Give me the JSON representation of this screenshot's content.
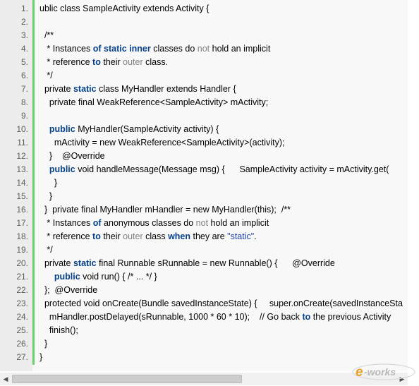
{
  "editor": {
    "lines": [
      {
        "n": "1.",
        "indent": "",
        "segments": [
          {
            "t": "ublic class SampleActivity extends Activity {",
            "c": "txt"
          }
        ]
      },
      {
        "n": "2.",
        "indent": "",
        "segments": []
      },
      {
        "n": "3.",
        "indent": "  ",
        "segments": [
          {
            "t": "/**",
            "c": "txt"
          }
        ]
      },
      {
        "n": "4.",
        "indent": "   ",
        "segments": [
          {
            "t": "* Instances ",
            "c": "txt"
          },
          {
            "t": "of",
            "c": "kw"
          },
          {
            "t": " ",
            "c": "txt"
          },
          {
            "t": "static",
            "c": "kw"
          },
          {
            "t": " ",
            "c": "txt"
          },
          {
            "t": "inner",
            "c": "kw"
          },
          {
            "t": " classes do ",
            "c": "txt"
          },
          {
            "t": "not",
            "c": "fn"
          },
          {
            "t": " hold an implicit",
            "c": "txt"
          }
        ]
      },
      {
        "n": "5.",
        "indent": "   ",
        "segments": [
          {
            "t": "* reference ",
            "c": "txt"
          },
          {
            "t": "to",
            "c": "kw"
          },
          {
            "t": " their ",
            "c": "txt"
          },
          {
            "t": "outer",
            "c": "fn"
          },
          {
            "t": " class.",
            "c": "txt"
          }
        ]
      },
      {
        "n": "6.",
        "indent": "   ",
        "segments": [
          {
            "t": "*/",
            "c": "txt"
          }
        ]
      },
      {
        "n": "7.",
        "indent": "  ",
        "segments": [
          {
            "t": "private ",
            "c": "txt"
          },
          {
            "t": "static",
            "c": "kw"
          },
          {
            "t": " class MyHandler extends Handler {",
            "c": "txt"
          }
        ]
      },
      {
        "n": "8.",
        "indent": "    ",
        "segments": [
          {
            "t": "private final WeakReference<SampleActivity> mActivity;",
            "c": "txt"
          }
        ]
      },
      {
        "n": "9.",
        "indent": "",
        "segments": []
      },
      {
        "n": "10.",
        "indent": "    ",
        "segments": [
          {
            "t": "public",
            "c": "kw"
          },
          {
            "t": " MyHandler(SampleActivity activity) {",
            "c": "txt"
          }
        ]
      },
      {
        "n": "11.",
        "indent": "      ",
        "segments": [
          {
            "t": "mActivity = new WeakReference<SampleActivity>(activity);",
            "c": "txt"
          }
        ]
      },
      {
        "n": "12.",
        "indent": "    ",
        "segments": [
          {
            "t": "}    @Override",
            "c": "txt"
          }
        ]
      },
      {
        "n": "13.",
        "indent": "    ",
        "segments": [
          {
            "t": "public",
            "c": "kw"
          },
          {
            "t": " void handleMessage(Message msg) {      SampleActivity activity = mActivity.get(",
            "c": "txt"
          }
        ]
      },
      {
        "n": "14.",
        "indent": "      ",
        "segments": [
          {
            "t": "}",
            "c": "txt"
          }
        ]
      },
      {
        "n": "15.",
        "indent": "    ",
        "segments": [
          {
            "t": "}",
            "c": "txt"
          }
        ]
      },
      {
        "n": "16.",
        "indent": "  ",
        "segments": [
          {
            "t": "}  private final MyHandler mHandler = new MyHandler(this);  /**",
            "c": "txt"
          }
        ]
      },
      {
        "n": "17.",
        "indent": "   ",
        "segments": [
          {
            "t": "* Instances ",
            "c": "txt"
          },
          {
            "t": "of",
            "c": "kw"
          },
          {
            "t": " anonymous classes do ",
            "c": "txt"
          },
          {
            "t": "not",
            "c": "fn"
          },
          {
            "t": " hold an implicit",
            "c": "txt"
          }
        ]
      },
      {
        "n": "18.",
        "indent": "   ",
        "segments": [
          {
            "t": "* reference ",
            "c": "txt"
          },
          {
            "t": "to",
            "c": "kw"
          },
          {
            "t": " their ",
            "c": "txt"
          },
          {
            "t": "outer",
            "c": "fn"
          },
          {
            "t": " class ",
            "c": "txt"
          },
          {
            "t": "when",
            "c": "kw"
          },
          {
            "t": " they are ",
            "c": "txt"
          },
          {
            "t": "\"static\"",
            "c": "str"
          },
          {
            "t": ".",
            "c": "txt"
          }
        ]
      },
      {
        "n": "19.",
        "indent": "   ",
        "segments": [
          {
            "t": "*/",
            "c": "txt"
          }
        ]
      },
      {
        "n": "20.",
        "indent": "  ",
        "segments": [
          {
            "t": "private ",
            "c": "txt"
          },
          {
            "t": "static",
            "c": "kw"
          },
          {
            "t": " final Runnable sRunnable = new Runnable() {      @Override",
            "c": "txt"
          }
        ]
      },
      {
        "n": "21.",
        "indent": "      ",
        "segments": [
          {
            "t": "public",
            "c": "kw"
          },
          {
            "t": " void run() { /* ... */ }",
            "c": "txt"
          }
        ]
      },
      {
        "n": "22.",
        "indent": "  ",
        "segments": [
          {
            "t": "};  @Override",
            "c": "txt"
          }
        ]
      },
      {
        "n": "23.",
        "indent": "  ",
        "segments": [
          {
            "t": "protected void onCreate(Bundle savedInstanceState) {     super.onCreate(savedInstanceSta",
            "c": "txt"
          }
        ]
      },
      {
        "n": "24.",
        "indent": "    ",
        "segments": [
          {
            "t": "mHandler.postDelayed(sRunnable, 1000 * 60 * 10);    // Go back ",
            "c": "txt"
          },
          {
            "t": "to",
            "c": "kw"
          },
          {
            "t": " the previous Activity",
            "c": "txt"
          }
        ]
      },
      {
        "n": "25.",
        "indent": "    ",
        "segments": [
          {
            "t": "finish();",
            "c": "txt"
          }
        ]
      },
      {
        "n": "26.",
        "indent": "  ",
        "segments": [
          {
            "t": "}",
            "c": "txt"
          }
        ]
      },
      {
        "n": "27.",
        "indent": "",
        "segments": [
          {
            "t": "}",
            "c": "txt"
          }
        ]
      }
    ]
  },
  "scrollbar": {
    "left_arrow": "◀",
    "right_arrow": "▶",
    "position_fraction": 0.0,
    "visible_fraction": 0.58
  },
  "watermark": {
    "text": "e-works",
    "colors": {
      "primary": "#e8a020",
      "accent": "#c0c0c0"
    }
  },
  "colors": {
    "keyword": "#06418a",
    "faded": "#808080",
    "string": "#2244aa",
    "gutter_bar": "#6ccf6c"
  }
}
